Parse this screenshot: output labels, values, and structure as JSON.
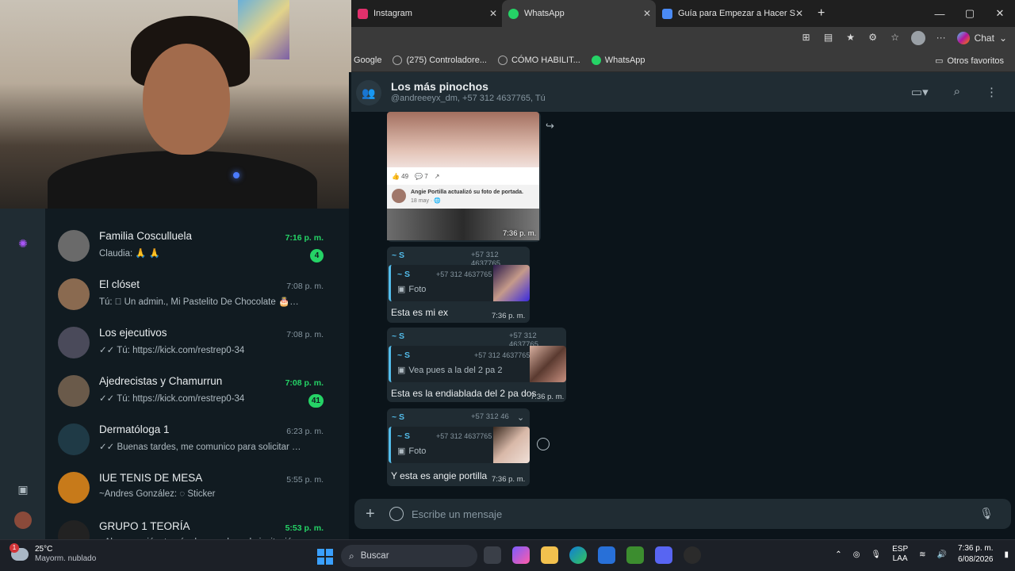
{
  "browser": {
    "tabs": [
      {
        "label": "Instagram",
        "color": "#e1306c"
      },
      {
        "label": "WhatsApp",
        "color": "#25d366"
      },
      {
        "label": "Guía para Empezar a Hacer Stream",
        "color": "#4a8af4"
      }
    ],
    "new_tab": "+",
    "window": {
      "minimize": "—",
      "maximize": "▢",
      "close": "✕"
    },
    "chat_label": "Chat",
    "bookmarks": [
      "Google",
      "(275) Controladore...",
      "CÓMO HABILIT...",
      "WhatsApp"
    ],
    "other_bookmarks": "Otros favoritos"
  },
  "sidebar": {
    "chats": [
      {
        "name": "Familia Cosculluela",
        "time": "7:16 p. m.",
        "unread": true,
        "message": "Claudia: 🙏 🙏",
        "badge": "4",
        "avatar": "#6a6a6a"
      },
      {
        "name": "El clóset",
        "time": "7:08 p. m.",
        "unread": false,
        "message": "Tú: ⃠ Un admin., Mi Pastelito De Chocolate 🎂🍫, eli...",
        "badge": "",
        "avatar": "#8a6a50"
      },
      {
        "name": "Los ejecutivos",
        "time": "7:08 p. m.",
        "unread": false,
        "message": "✓✓ Tú: https://kick.com/restrep0-34",
        "badge": "",
        "avatar": "#4a4a5a"
      },
      {
        "name": "Ajedrecistas y Chamurrun",
        "time": "7:08 p. m.",
        "unread": true,
        "message": "✓✓ Tú: https://kick.com/restrep0-34",
        "badge": "41",
        "avatar": "#6a5a4a"
      },
      {
        "name": "Dermatóloga 1",
        "time": "6:23 p. m.",
        "unread": false,
        "message": "✓✓ Buenas tardes, me comunico para solicitar una cita...",
        "badge": "",
        "avatar": "#1f3a46"
      },
      {
        "name": "IUE TENIS DE MESA",
        "time": "5:55 p. m.",
        "unread": false,
        "message": "~Andres González: ◌ Sticker",
        "badge": "",
        "avatar": "#c77a1a"
      },
      {
        "name": "GRUPO 1 TEORÍA",
        "time": "5:53 p. m.",
        "unread": true,
        "message": "~Alex se unió a través de un enlace de invitación...",
        "badge": "",
        "avatar": "#222222"
      }
    ]
  },
  "conversation": {
    "title": "Los más pinochos",
    "subtitle": "@andreeeyx_dm, +57 312 4637765, Tú",
    "composer_placeholder": "Escribe un mensaje",
    "messages": [
      {
        "time": "7:36 p. m.",
        "reactions": [
          "👍 49",
          "💬 7",
          "↗"
        ],
        "fb_name": "Angie Portilla actualizó su foto de portada.",
        "fb_date": "18 may · 🌐"
      },
      {
        "sender": "~ S",
        "phone": "+57 312 4637765",
        "quote_sender": "~ S",
        "quote_phone": "+57 312 4637765",
        "quote_text": "Foto",
        "text": "Esta es mi ex",
        "time": "7:36 p. m."
      },
      {
        "sender": "~ S",
        "phone": "+57 312 4637765",
        "quote_sender": "~ S",
        "quote_phone": "+57 312 4637765",
        "quote_text": "Vea pues a la del 2 pa 2",
        "text": "Esta es la endiablada del 2 pa dos",
        "time": "7:36 p. m."
      },
      {
        "sender": "~ S",
        "phone": "+57 312 46",
        "quote_sender": "~ S",
        "quote_phone": "+57 312 4637765",
        "quote_text": "Foto",
        "text": "Y esta es angie portilla",
        "time": "7:36 p. m."
      }
    ]
  },
  "taskbar": {
    "weather_badge": "1",
    "weather_temp": "25°C",
    "weather_desc": "Mayorm. nublado",
    "search": "Buscar",
    "lang_top": "ESP",
    "lang_bottom": "LAA",
    "clock_time": "7:36 p. m.",
    "clock_date": "6/08/2026"
  }
}
